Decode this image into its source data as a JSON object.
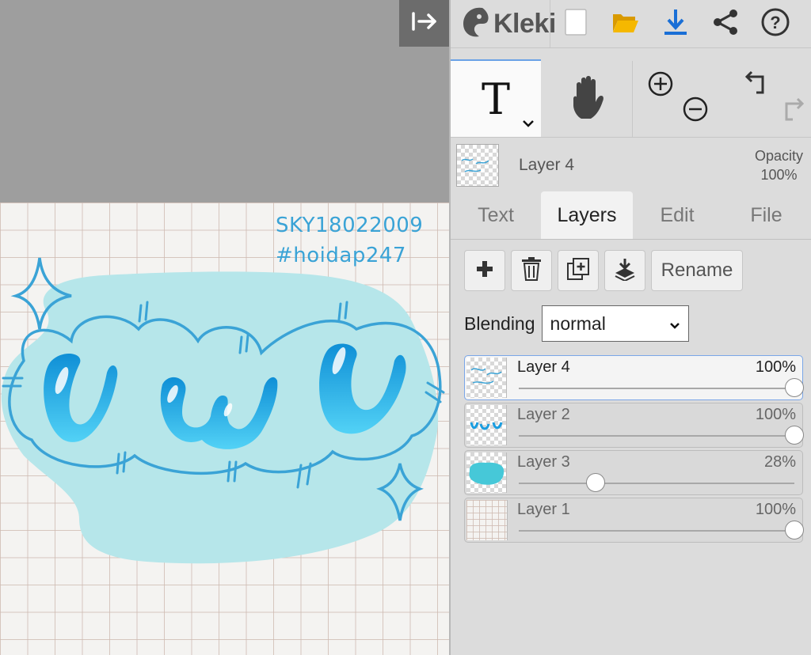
{
  "app": {
    "name": "Kleki"
  },
  "canvas": {
    "collapse_icon": "arrow-right-to-bar-icon",
    "artwork_text_line1": "SKY18022009",
    "artwork_text_line2": "#hoidap247",
    "artwork_lettering": "UwU"
  },
  "toolbar": {
    "icons": [
      "new-file-icon",
      "open-folder-icon",
      "download-icon",
      "share-icon",
      "help-icon"
    ],
    "colors": {
      "folder": "#f5b800",
      "download": "#1a6fd6"
    }
  },
  "tools": {
    "text": {
      "glyph": "T",
      "icon": "text-tool-icon"
    },
    "hand": {
      "icon": "hand-icon"
    },
    "zoom": {
      "icons": [
        "zoom-in-icon",
        "zoom-out-icon"
      ]
    },
    "history": {
      "icons": [
        "undo-icon",
        "redo-icon"
      ]
    }
  },
  "preview": {
    "layer_name": "Layer 4",
    "opacity_label": "Opacity",
    "opacity_value": "100%"
  },
  "tabs": [
    {
      "label": "Text",
      "active": false
    },
    {
      "label": "Layers",
      "active": true
    },
    {
      "label": "Edit",
      "active": false
    },
    {
      "label": "File",
      "active": false
    }
  ],
  "layer_actions": {
    "icons": [
      "plus-icon",
      "trash-icon",
      "duplicate-icon",
      "merge-down-icon"
    ],
    "rename_label": "Rename"
  },
  "blending": {
    "label": "Blending",
    "value": "normal"
  },
  "layers": [
    {
      "name": "Layer 4",
      "opacity_label": "100%",
      "opacity": 1.0,
      "selected": true
    },
    {
      "name": "Layer 2",
      "opacity_label": "100%",
      "opacity": 1.0,
      "selected": false
    },
    {
      "name": "Layer 3",
      "opacity_label": "28%",
      "opacity": 0.28,
      "selected": false
    },
    {
      "name": "Layer 1",
      "opacity_label": "100%",
      "opacity": 1.0,
      "selected": false
    }
  ],
  "colors": {
    "accent": "#6aa2e6",
    "art_blue": "#3aa3d6",
    "art_blob": "#b6e6ea",
    "layer3_blob": "#46c8d8"
  }
}
